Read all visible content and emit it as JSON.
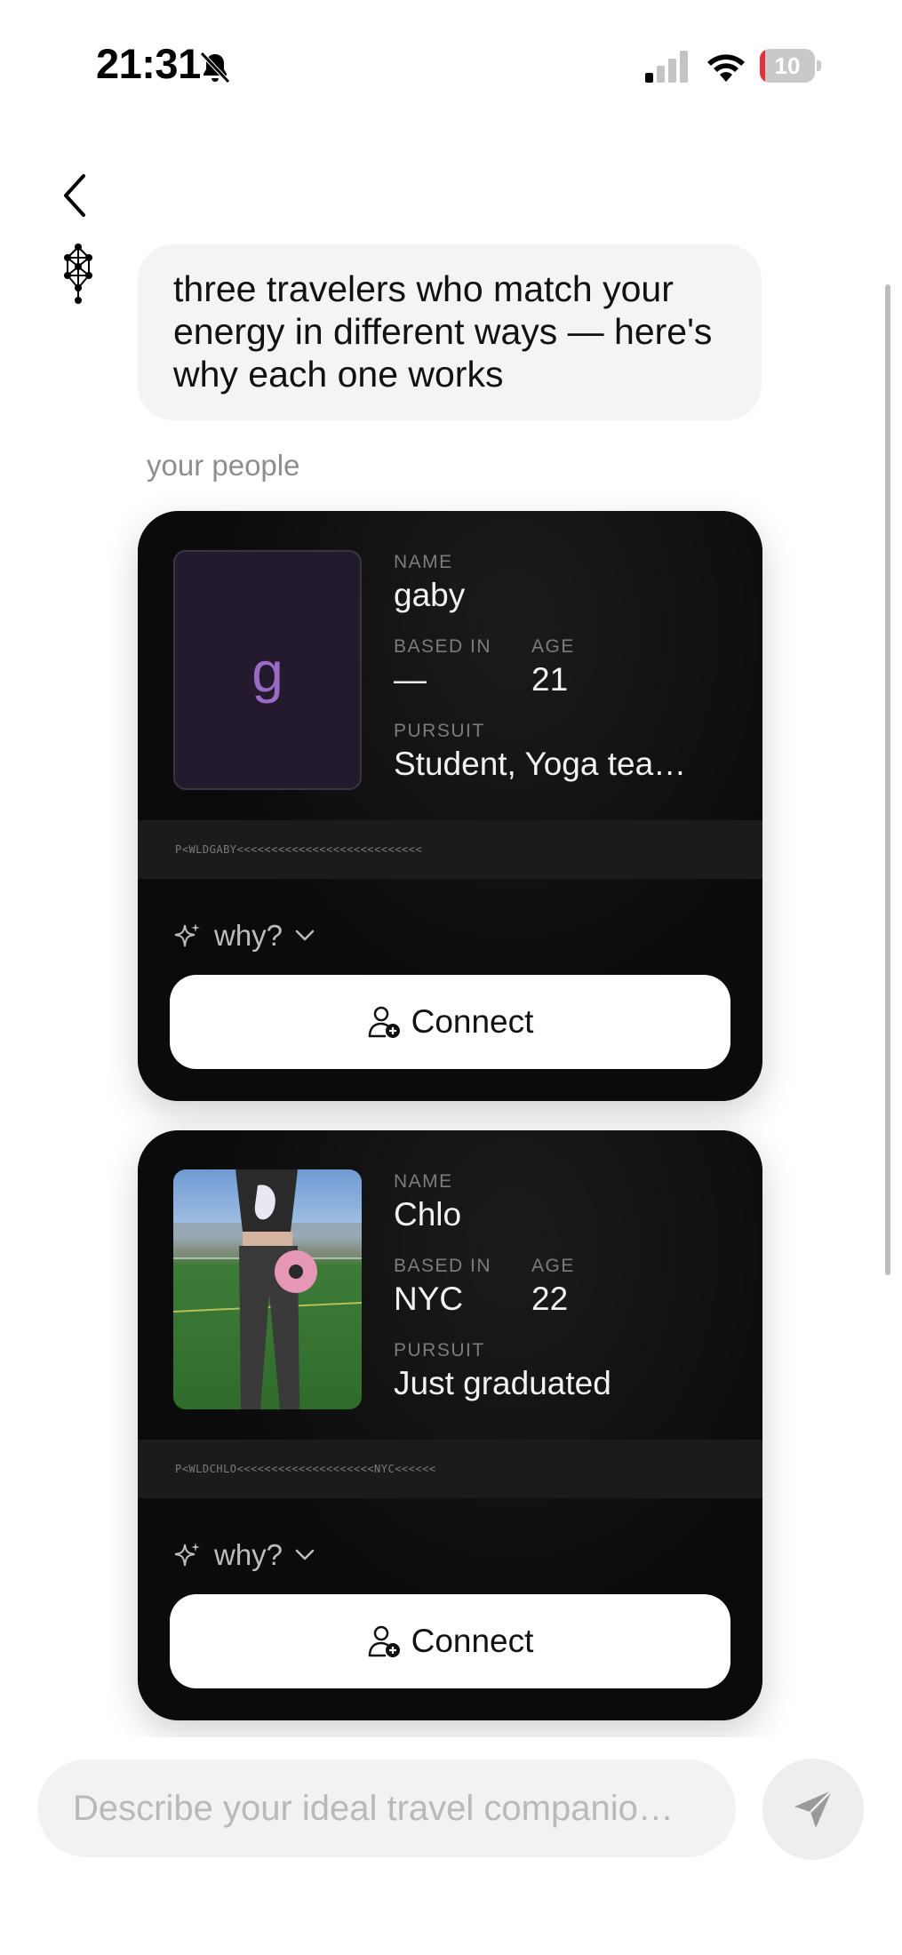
{
  "status_bar": {
    "time": "21:31",
    "battery_level": "10",
    "battery_fraction": 0.1,
    "signal_bars_active": 1,
    "icons": [
      "bell-muted-icon",
      "cellular-signal-icon",
      "wifi-icon",
      "battery-icon"
    ]
  },
  "header": {
    "back_icon": "chevron-left-icon",
    "bot_avatar_icon": "tree-of-life-icon"
  },
  "message": {
    "text": "three travelers who match your energy in different ways — here's why each one works"
  },
  "section": {
    "label": "your people"
  },
  "cards": [
    {
      "photo_placeholder": "g",
      "name_label": "NAME",
      "name": "gaby",
      "based_label": "BASED IN",
      "based": "—",
      "age_label": "AGE",
      "age": "21",
      "pursuit_label": "PURSUIT",
      "pursuit": "Student, Yoga tea…",
      "mrz": "P<WLDGABY<<<<<<<<<<<<<<<<<<<<<<<<<<<",
      "why_label": "why?",
      "connect_label": "Connect"
    },
    {
      "name_label": "NAME",
      "name": "Chlo",
      "based_label": "BASED IN",
      "based": "NYC",
      "age_label": "AGE",
      "age": "22",
      "pursuit_label": "PURSUIT",
      "pursuit": "Just graduated",
      "mrz": "P<WLDCHLO<<<<<<<<<<<<<<<<<<<<NYC<<<<<<",
      "why_label": "why?",
      "connect_label": "Connect"
    }
  ],
  "composer": {
    "placeholder": "Describe your ideal travel companio…",
    "send_icon": "send-arrow-icon"
  },
  "colors": {
    "card_bg": "#0b0b0b",
    "placeholder_letter": "#9a6bc4",
    "battery_low": "#e5303a"
  }
}
